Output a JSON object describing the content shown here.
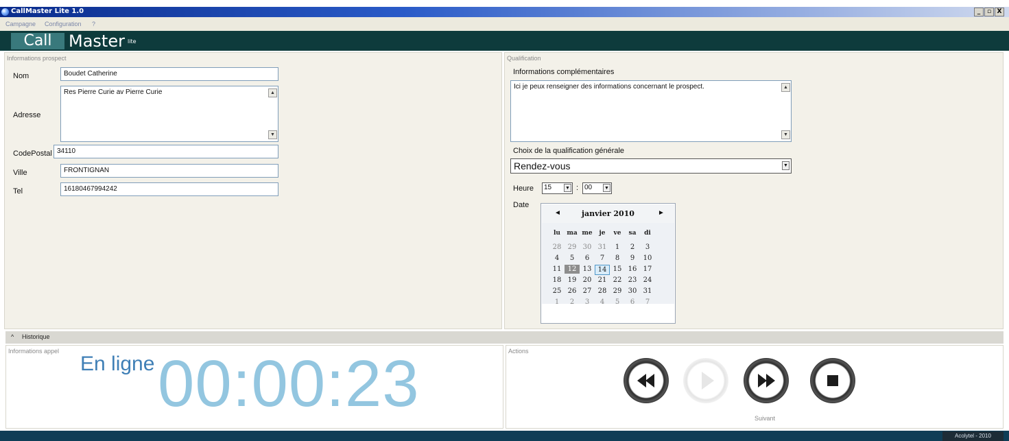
{
  "window": {
    "title": "CallMaster Lite 1.0",
    "buttons": [
      "_",
      "▫",
      "X"
    ]
  },
  "menu": {
    "items": [
      "Campagne",
      "Configuration",
      "?"
    ]
  },
  "banner": {
    "call": "Call",
    "master": "Master",
    "lite": "lite"
  },
  "prospect": {
    "section_title": "Informations prospect",
    "nom_label": "Nom",
    "nom_value": "Boudet Catherine",
    "adresse_label": "Adresse",
    "adresse_value": "Res Pierre Curie av Pierre Curie",
    "cp_label": "CodePostal",
    "cp_value": "34110",
    "ville_label": "Ville",
    "ville_value": "FRONTIGNAN",
    "tel_label": "Tel",
    "tel_value": "16180467994242"
  },
  "qualification": {
    "section_title": "Qualification",
    "info_label": "Informations complémentaires",
    "info_value": "Ici je peux renseigner des informations concernant le prospect.",
    "choice_label": "Choix de la qualification générale",
    "choice_value": "Rendez-vous",
    "heure_label": "Heure",
    "hour": "15",
    "sep": ":",
    "minute": "00",
    "date_label": "Date"
  },
  "calendar": {
    "month": "janvier 2010",
    "prev": "◄",
    "next": "►",
    "weekdays": [
      "lu",
      "ma",
      "me",
      "je",
      "ve",
      "sa",
      "di"
    ],
    "weeks": [
      [
        "28",
        "29",
        "30",
        "31",
        "1",
        "2",
        "3"
      ],
      [
        "4",
        "5",
        "6",
        "7",
        "8",
        "9",
        "10"
      ],
      [
        "11",
        "12",
        "13",
        "14",
        "15",
        "16",
        "17"
      ],
      [
        "18",
        "19",
        "20",
        "21",
        "22",
        "23",
        "24"
      ],
      [
        "25",
        "26",
        "27",
        "28",
        "29",
        "30",
        "31"
      ],
      [
        "1",
        "2",
        "3",
        "4",
        "5",
        "6",
        "7"
      ]
    ],
    "selected_day": "12",
    "today": "14"
  },
  "historique": {
    "toggle": "^",
    "label": "Historique"
  },
  "call_info": {
    "section_title": "Informations appel",
    "status": "En ligne",
    "timer": "00:00:23"
  },
  "actions": {
    "section_title": "Actions",
    "next_label": "Suivant"
  },
  "footer": {
    "credit": "Acolytel - 2010"
  }
}
